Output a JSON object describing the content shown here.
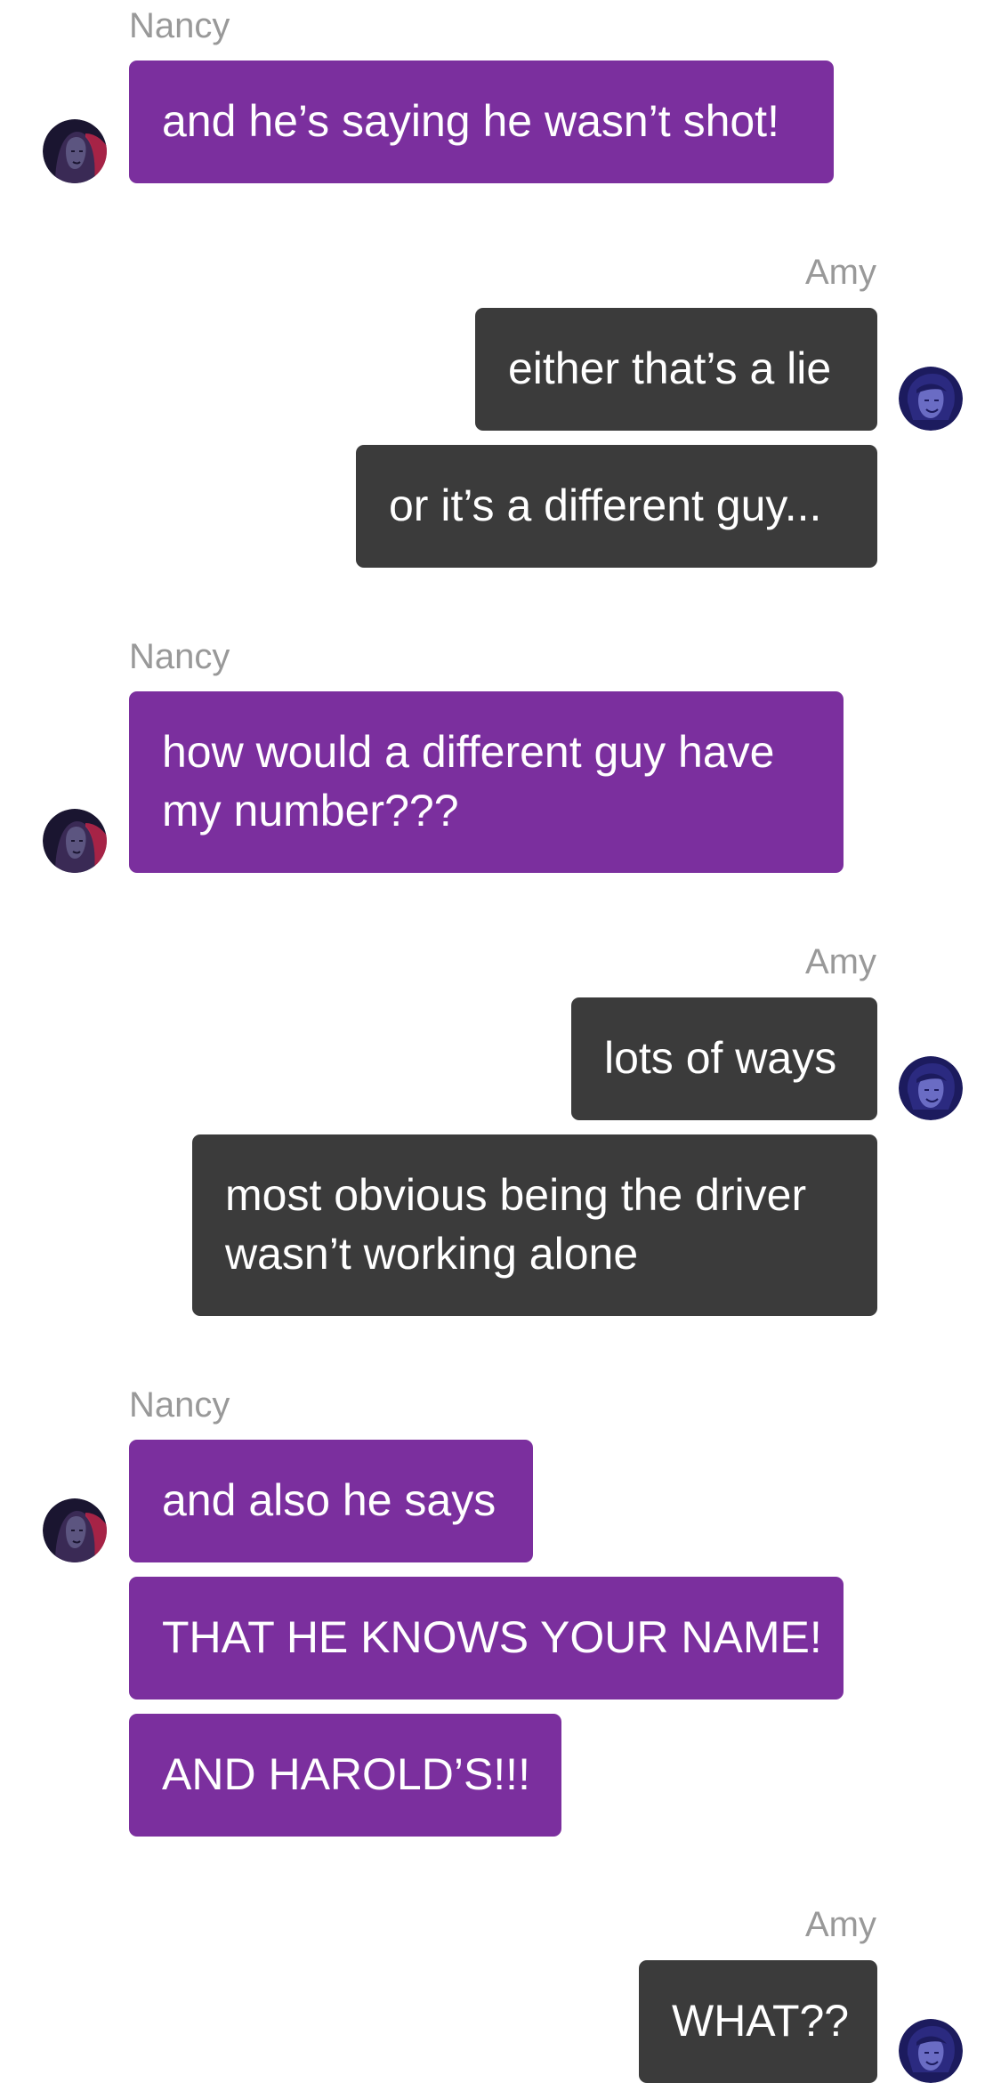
{
  "conversation": {
    "blocks": [
      {
        "sender": "Nancy",
        "side": "left",
        "messages": [
          "and he’s saying he wasn’t shot!"
        ]
      },
      {
        "sender": "Amy",
        "side": "right",
        "messages": [
          "either that’s a lie",
          "or it’s a different guy..."
        ]
      },
      {
        "sender": "Nancy",
        "side": "left",
        "messages": [
          "how would a different guy have my number???"
        ]
      },
      {
        "sender": "Amy",
        "side": "right",
        "messages": [
          "lots of ways",
          "most obvious being the driver wasn’t working alone"
        ]
      },
      {
        "sender": "Nancy",
        "side": "left",
        "messages": [
          "and also he says",
          "THAT HE KNOWS YOUR NAME!",
          "AND HAROLD’S!!!"
        ]
      },
      {
        "sender": "Amy",
        "side": "right",
        "messages": [
          "WHAT??"
        ]
      }
    ]
  },
  "colors": {
    "nancy_bubble": "#7b2f9e",
    "amy_bubble": "#3b3b3b",
    "sender_name": "#999999",
    "background": "#ffffff"
  },
  "icons": {
    "nancy_avatar": "nancy-avatar-icon",
    "amy_avatar": "amy-avatar-icon"
  }
}
